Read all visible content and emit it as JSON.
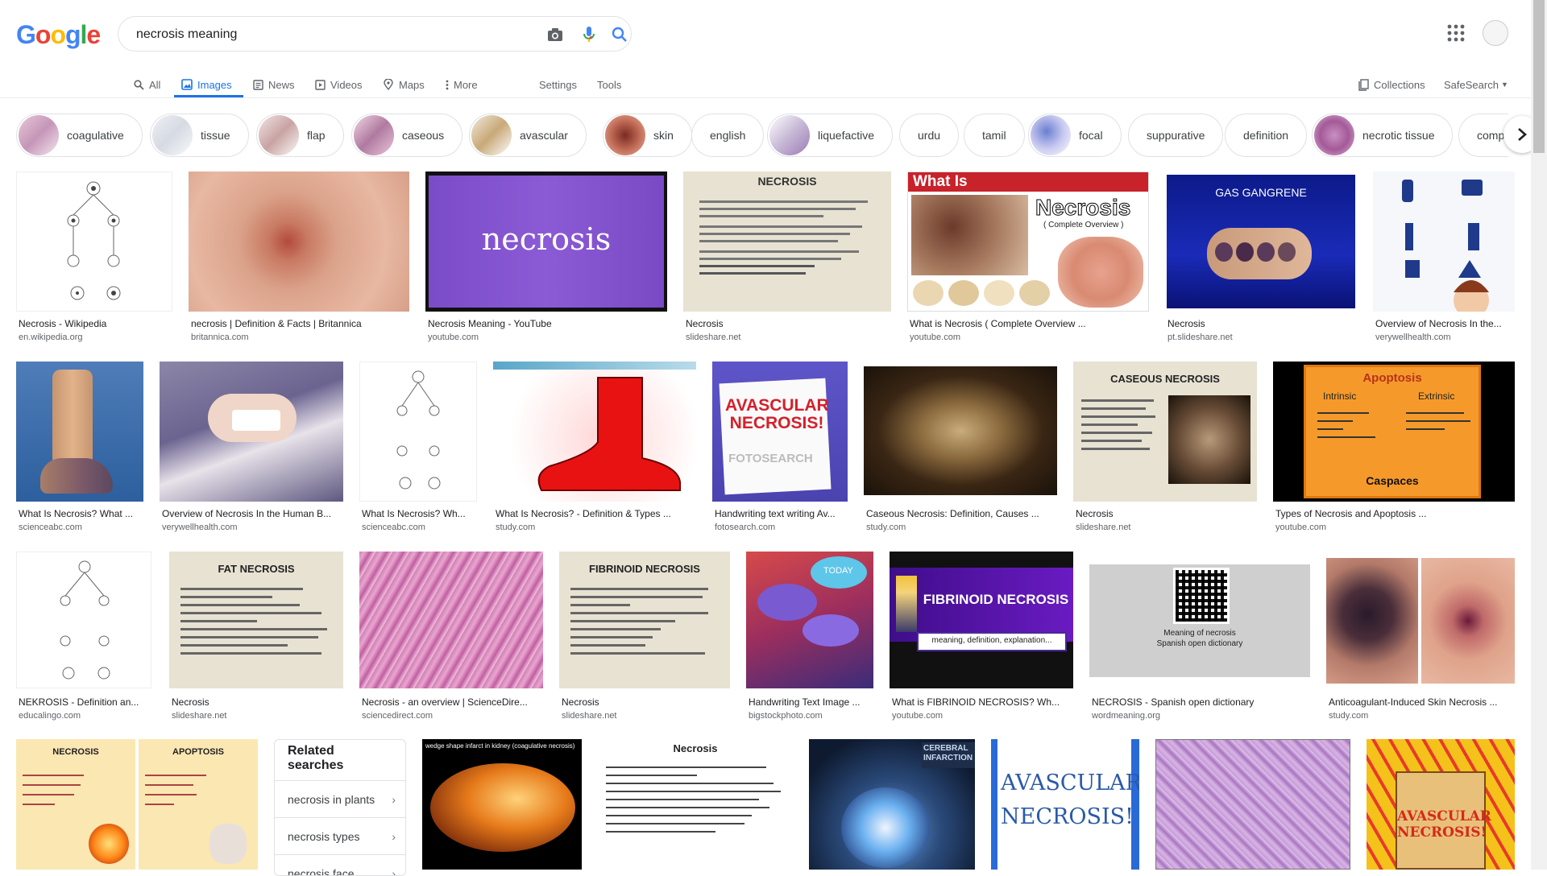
{
  "logo": "Google",
  "search": {
    "query": "necrosis meaning"
  },
  "tabs": [
    {
      "label": "All"
    },
    {
      "label": "Images"
    },
    {
      "label": "News"
    },
    {
      "label": "Videos"
    },
    {
      "label": "Maps"
    },
    {
      "label": "More"
    }
  ],
  "tools": {
    "settings": "Settings",
    "tools": "Tools"
  },
  "right_links": {
    "collections": "Collections",
    "safesearch": "SafeSearch"
  },
  "chips": [
    "coagulative",
    "tissue",
    "flap",
    "caseous",
    "avascular",
    "skin",
    "english",
    "liquefactive",
    "urdu",
    "tamil",
    "focal",
    "suppurative",
    "definition",
    "necrotic tissue",
    "comp"
  ],
  "results": [
    {
      "title": "Necrosis - Wikipedia",
      "site": "en.wikipedia.org"
    },
    {
      "title": "necrosis | Definition & Facts | Britannica",
      "site": "britannica.com"
    },
    {
      "title": "Necrosis Meaning - YouTube",
      "site": "youtube.com"
    },
    {
      "title": "Necrosis",
      "site": "slideshare.net"
    },
    {
      "title": "What is Necrosis ( Complete Overview ...",
      "site": "youtube.com"
    },
    {
      "title": "Necrosis",
      "site": "pt.slideshare.net"
    },
    {
      "title": "Overview of Necrosis In the...",
      "site": "verywellhealth.com"
    },
    {
      "title": "What Is Necrosis? What ...",
      "site": "scienceabc.com"
    },
    {
      "title": "Overview of Necrosis In the Human B...",
      "site": "verywellhealth.com"
    },
    {
      "title": "What Is Necrosis? Wh...",
      "site": "scienceabc.com"
    },
    {
      "title": "What Is Necrosis? - Definition & Types ...",
      "site": "study.com"
    },
    {
      "title": "Handwriting text writing Av...",
      "site": "fotosearch.com"
    },
    {
      "title": "Caseous Necrosis: Definition, Causes ...",
      "site": "study.com"
    },
    {
      "title": "Necrosis",
      "site": "slideshare.net"
    },
    {
      "title": "Types of Necrosis and Apoptosis ...",
      "site": "youtube.com"
    },
    {
      "title": "NEKROSIS - Definition an...",
      "site": "educalingo.com"
    },
    {
      "title": "Necrosis",
      "site": "slideshare.net"
    },
    {
      "title": "Necrosis - an overview | ScienceDire...",
      "site": "sciencedirect.com"
    },
    {
      "title": "Necrosis",
      "site": "slideshare.net"
    },
    {
      "title": "Handwriting Text Image ...",
      "site": "bigstockphoto.com"
    },
    {
      "title": "What is FIBRINOID NECROSIS? Wh...",
      "site": "youtube.com"
    },
    {
      "title": "NECROSIS - Spanish open dictionary",
      "site": "wordmeaning.org"
    },
    {
      "title": "Anticoagulant-Induced Skin Necrosis ...",
      "site": "study.com"
    }
  ],
  "image_text": {
    "necrosis_word": "necrosis",
    "gas_gangrene": "GAS GANGRENE",
    "necrosis_heading": "NECROSIS",
    "what_is": "What Is",
    "necrosis_title": "Necrosis",
    "complete_overview": "( Complete Overview )",
    "avascular": "AVASCULAR NECROSIS!",
    "fotosearch": "FOTOSEARCH",
    "caseous_heading": "CASEOUS NECROSIS",
    "apoptosis": "Apoptosis",
    "intrinsic": "Intrinsic",
    "extrinsic": "Extrinsic",
    "caspaces": "Caspaces",
    "fat_necrosis": "FAT NECROSIS",
    "fibrinoid_necrosis": "FIBRINOID NECROSIS",
    "fibrinoid_sub": "meaning, definition, explanation...",
    "today": "TODAY",
    "meaning_of": "Meaning of necrosis",
    "spanish_dict": "Spanish open dictionary",
    "necrosis_col": "NECROSIS",
    "apoptosis_col": "APOPTOSIS",
    "kidney": "wedge shape infarct in kidney (coagulative necrosis)",
    "cerebral": "CEREBRAL INFARCTION"
  },
  "related": {
    "heading": "Related searches",
    "items": [
      "necrosis in plants",
      "necrosis types",
      "necrosis face"
    ]
  },
  "colors": {
    "accent": "#1a73e8",
    "chip_border": "#dfe1e5",
    "muted": "#5f6368"
  }
}
